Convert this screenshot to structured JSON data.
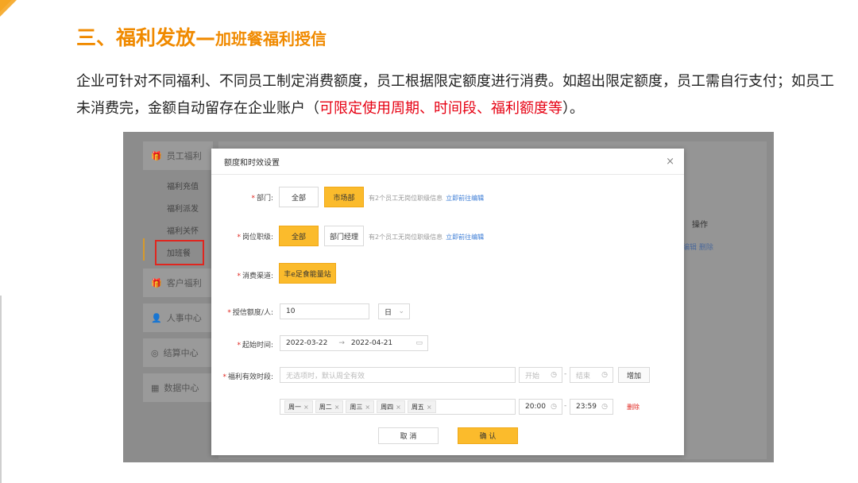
{
  "slide": {
    "title_main": "三、福利发放—",
    "title_sub": "加班餐福利授信",
    "desc_part1": "企业可针对不同福利、不同员工制定消费额度，员工根据限定额度进行消费。如超出限定额度，员工需自行支付；如员工未消费完，金额自动留存在企业账户（",
    "desc_highlight": "可限定使用周期、时间段、福利额度等",
    "desc_part2": "）。"
  },
  "sidebar": {
    "groups": [
      {
        "label": "员工福利",
        "icon": "gift-icon"
      },
      {
        "label": "客户福利",
        "icon": "gift-icon"
      },
      {
        "label": "人事中心",
        "icon": "person-icon"
      },
      {
        "label": "结算中心",
        "icon": "settle-icon"
      },
      {
        "label": "数据中心",
        "icon": "chart-icon"
      }
    ],
    "sub_items": [
      "福利充值",
      "福利派发",
      "福利关怀",
      "加班餐"
    ]
  },
  "background_table": {
    "op_header": "操作",
    "row_links": [
      "编辑",
      "删除"
    ]
  },
  "modal": {
    "title": "额度和时效设置",
    "close": "×",
    "dept": {
      "label": "部门:",
      "options": [
        "全部",
        "市场部"
      ],
      "selected": "市场部",
      "hint": "有2个员工无岗位职级信息",
      "hint_link": "立即前往编辑"
    },
    "position": {
      "label": "岗位职级:",
      "options": [
        "全部",
        "部门经理"
      ],
      "selected": "全部",
      "hint": "有2个员工无岗位职级信息",
      "hint_link": "立即前往编辑"
    },
    "channel": {
      "label": "消费渠道:",
      "options": [
        "丰e足食能量站"
      ],
      "selected": "丰e足食能量站"
    },
    "credit": {
      "label": "授信额度/人:",
      "value": "10",
      "unit": "日"
    },
    "period": {
      "label": "起始时间:",
      "start": "2022-03-22",
      "arrow": "→",
      "end": "2022-04-21"
    },
    "valid_time": {
      "label": "福利有效时段:",
      "placeholder": "无选项时，默认周全有效",
      "start_placeholder": "开始",
      "end_placeholder": "结束",
      "dash": "-",
      "add_button": "增加",
      "weekdays": [
        "周一",
        "周二",
        "周三",
        "周四",
        "周五"
      ],
      "row_start": "20:00",
      "row_end": "23:59",
      "delete": "删除"
    },
    "cancel": "取 消",
    "confirm": "确 认"
  },
  "colors": {
    "accent": "#fbbb2c",
    "title": "#f08a00",
    "highlight": "#e60012",
    "link": "#3a7bd5"
  }
}
